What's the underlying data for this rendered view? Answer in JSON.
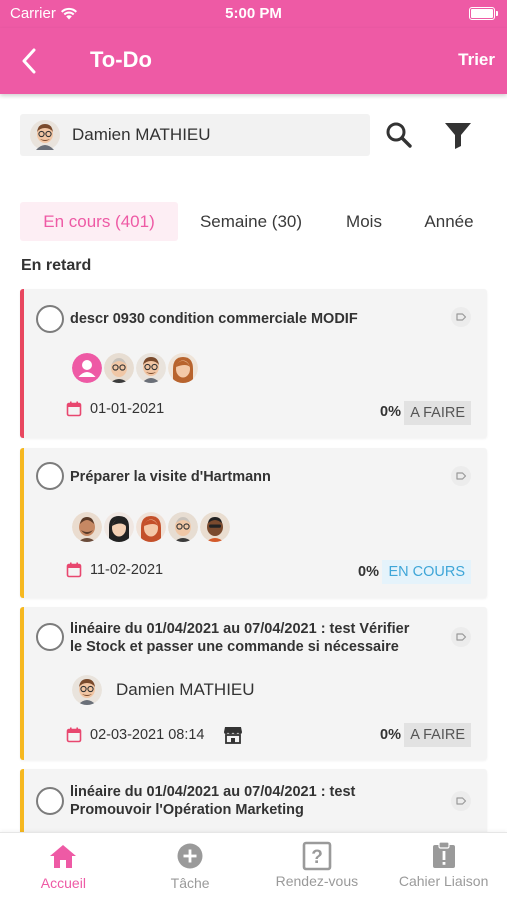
{
  "status_bar": {
    "carrier": "Carrier",
    "time": "5:00 PM"
  },
  "header": {
    "title": "To-Do",
    "sort_label": "Trier"
  },
  "user_filter": {
    "name": "Damien MATHIEU"
  },
  "tabs": [
    {
      "label": "En cours (401)",
      "active": true
    },
    {
      "label": "Semaine (30)",
      "active": false
    },
    {
      "label": "Mois",
      "active": false
    },
    {
      "label": "Année",
      "active": false
    }
  ],
  "section_title": "En retard",
  "tasks": [
    {
      "title": "descr 0930 condition commerciale MODIF",
      "date": "01-01-2021",
      "progress": "0%",
      "status": "A FAIRE",
      "priority_color": "#e8475f"
    },
    {
      "title": "Préparer la visite d'Hartmann",
      "date": "11-02-2021",
      "progress": "0%",
      "status": "EN COURS",
      "priority_color": "#f6b820"
    },
    {
      "title_line1": "linéaire du 01/04/2021 au 07/04/2021 : test Vérifier",
      "title_line2": "le Stock et passer une commande si nécessaire",
      "assignee": "Damien MATHIEU",
      "date": "02-03-2021 08:14",
      "progress": "0%",
      "status": "A FAIRE",
      "priority_color": "#f6b820"
    },
    {
      "title_line1": "linéaire du 01/04/2021 au 07/04/2021 : test",
      "title_line2": "Promouvoir l'Opération Marketing",
      "priority_color": "#f6b820"
    }
  ],
  "bottom_nav": [
    {
      "label": "Accueil",
      "icon": "home-icon",
      "active": true
    },
    {
      "label": "Tâche",
      "icon": "add-circle-icon",
      "active": false
    },
    {
      "label": "Rendez-vous",
      "icon": "question-box-icon",
      "active": false
    },
    {
      "label": "Cahier Liaison",
      "icon": "clipboard-alert-icon",
      "active": false
    }
  ],
  "colors": {
    "accent": "#ee5aa5",
    "late": "#e8475f",
    "warning": "#f6b820",
    "in_progress": "#3fa6d8"
  }
}
